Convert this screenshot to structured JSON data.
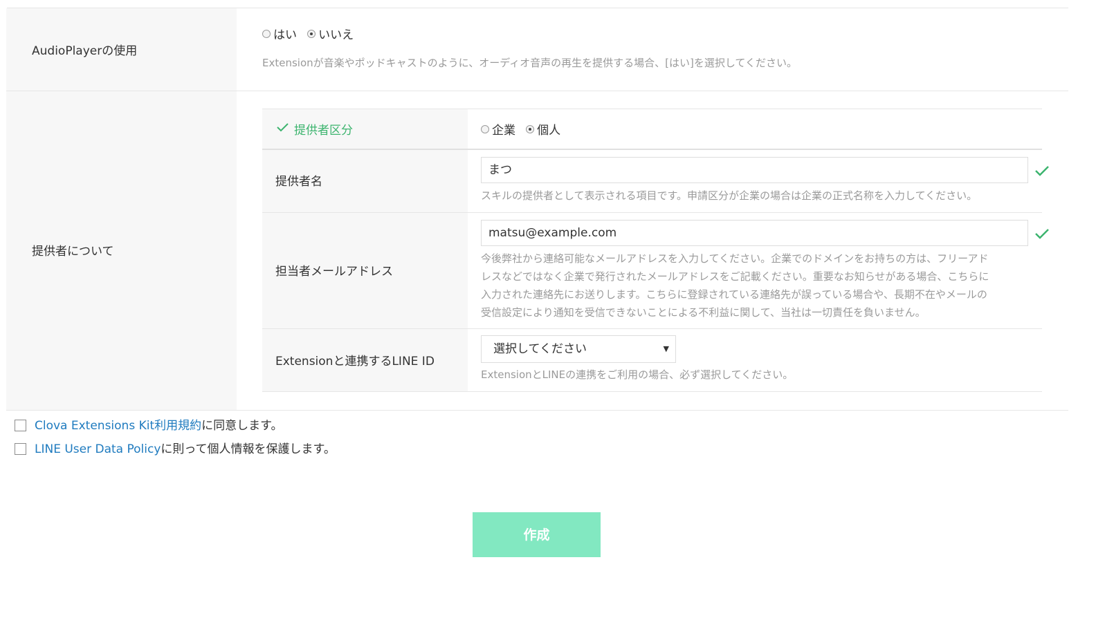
{
  "audio_player": {
    "label": "AudioPlayerの使用",
    "option_yes": "はい",
    "option_no": "いいえ",
    "selected": "いいえ",
    "help": "Extensionが音楽やポッドキャストのように、オーディオ音声の再生を提供する場合、[はい]を選択してください。"
  },
  "provider": {
    "section_label": "提供者について",
    "category": {
      "label": "提供者区分",
      "option_company": "企業",
      "option_individual": "個人",
      "selected": "個人"
    },
    "name": {
      "label": "提供者名",
      "value": "まつ",
      "help": "スキルの提供者として表示される項目です。申請区分が企業の場合は企業の正式名称を入力してください。"
    },
    "email": {
      "label": "担当者メールアドレス",
      "value": "matsu@example.com",
      "help_lines": [
        "今後弊社から連絡可能なメールアドレスを入力してください。企業でのドメインをお持ちの方は、フリーアド",
        "レスなどではなく企業で発行されたメールアドレスをご記載ください。重要なお知らせがある場合、こちらに",
        "入力された連絡先にお送りします。こちらに登録されている連絡先が誤っている場合や、長期不在やメールの",
        "受信設定により通知を受信できないことによる不利益に関して、当社は一切責任を負いません。"
      ]
    },
    "line_id": {
      "label": "Extensionと連携するLINE ID",
      "select_value": "選択してください",
      "help": "ExtensionとLINEの連携をご利用の場合、必ず選択してください。"
    }
  },
  "agreements": [
    {
      "link": "Clova Extensions Kit利用規約",
      "text": "に同意します。",
      "checked": false
    },
    {
      "link": "LINE User Data Policy",
      "text": "に則って個人情報を保護します。",
      "checked": false
    }
  ],
  "create_button": "作成",
  "colors": {
    "accent_green": "#3cb46e",
    "link_blue": "#1f7bbf",
    "button_bg": "#82e8c1"
  }
}
